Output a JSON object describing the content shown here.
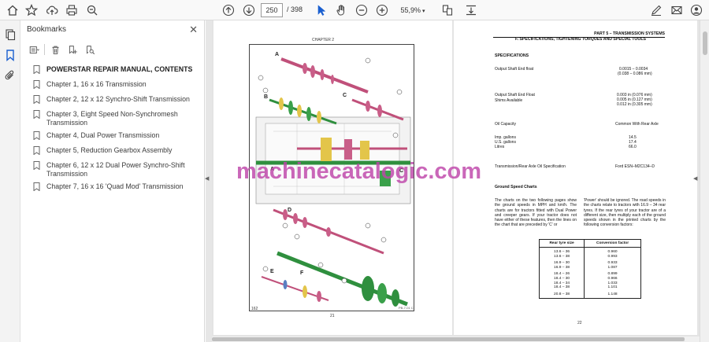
{
  "toolbar": {
    "page_current": "250",
    "page_total": "/ 398",
    "zoom": "55,9%"
  },
  "panel": {
    "title": "Bookmarks",
    "items": [
      {
        "label": "POWERSTAR REPAIR MANUAL, CONTENTS"
      },
      {
        "label": "Chapter 1, 16 x 16 Transmission"
      },
      {
        "label": "Chapter 2, 12 x 12 Synchro-Shift Transmission"
      },
      {
        "label": "Chapter 3, Eight Speed Non-Synchromesh Transmission"
      },
      {
        "label": "Chapter 4, Dual Power Transmission"
      },
      {
        "label": "Chapter 5, Reduction Gearbox Assembly"
      },
      {
        "label": "Chapter 6, 12 x 12 Dual Power Synchro-Shift Transmission"
      },
      {
        "label": "Chapter 7, 16 x 16 'Quad Mod' Transmission"
      }
    ]
  },
  "left_page": {
    "chapter": "CHAPTER 2",
    "page_number": "21",
    "fig_ref": "PB-7-01 C",
    "corner_label": "162",
    "labels": [
      "A",
      "B",
      "C",
      "A",
      "C",
      "D",
      "E",
      "F"
    ]
  },
  "right_page": {
    "part_header": "PART 5 – TRANSMISSION SYSTEMS",
    "section_header": "F.   SPECIFICATIONS, TIGHTENING TORQUES AND SPECIAL TOOLS",
    "specs_title": "SPECIFICATIONS",
    "output_shaft_label": "Output Shaft End float",
    "output_shaft_val1": "0.0015 – 0.0034",
    "output_shaft_val2": "(0.038 – 0.086 mm)",
    "output_flange_label": "Output Shaft End Float",
    "shims_label": "Shims Available",
    "shim1": "0.003 in (0.076 mm)",
    "shim2": "0.005 in (0.127 mm)",
    "shim3": "0.012 in (0.305 mm)",
    "oil_capacity_label": "Oil Capacity",
    "oil_capacity_val": "Common With Rear Axle",
    "imp_label": "Imp. gallons",
    "us_label": "U.S. gallons",
    "litres_label": "Litres",
    "imp_val": "14.5",
    "us_val": "17.4",
    "litres_val": "66.0",
    "oil_spec_label": "Transmission/Rear Axle Oil Specification",
    "oil_spec_val": "Ford ESN–M2C134–D",
    "ground_speed_title": "Ground Speed Charts",
    "para_left": "The charts on the two following pages show the ground speeds in MPH and km/h. The charts are for tractors fitted with Dual Power and creeper gears. If your tractor does not have either of these features, then the lines on the chart that are preceded by 'C' or",
    "para_right": "'Power' should be ignored. The road speeds in the charts relate to tractors with 16.9 – 34 rear tyres. If the rear tyres of your tractor are of a different size, then multiply each of the ground speeds shown in the printed charts by the following conversion factors:",
    "table_head": [
      "Rear tyre size",
      "Conversion factor"
    ],
    "table_rows": [
      [
        "13.6 – 36",
        "0.960"
      ],
      [
        "13.6 – 38",
        "0.993"
      ],
      [
        "16.9 – 30",
        "0.933"
      ],
      [
        "16.9 – 38",
        "1.087"
      ],
      [
        "18.4 – 26",
        "0.899"
      ],
      [
        "18.4 – 30",
        "0.966"
      ],
      [
        "18.4 – 34",
        "1.033"
      ],
      [
        "18.4 – 38",
        "1.101"
      ],
      [
        "20.8 – 38",
        "1.148"
      ]
    ],
    "page_number": "22"
  },
  "watermark": "machinecatalogic.com"
}
